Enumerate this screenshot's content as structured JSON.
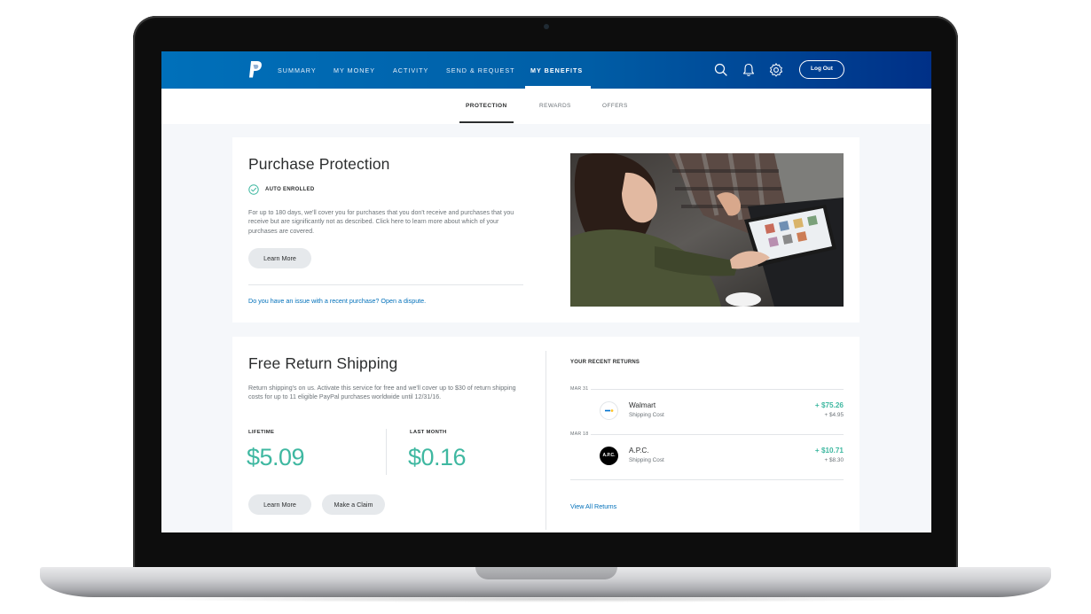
{
  "nav": {
    "items": [
      "SUMMARY",
      "MY MONEY",
      "ACTIVITY",
      "SEND & REQUEST",
      "MY BENEFITS"
    ],
    "active": "MY BENEFITS",
    "logout_label": "Log Out"
  },
  "subnav": {
    "tabs": [
      "PROTECTION",
      "REWARDS",
      "OFFERS"
    ],
    "active": "PROTECTION"
  },
  "purchase_protection": {
    "title": "Purchase Protection",
    "badge": "AUTO ENROLLED",
    "description": "For up to 180 days, we'll cover you for purchases that you don't receive and purchases that you receive but are significantly not as described. Click here to learn more about which of your purchases are covered.",
    "learn_more_label": "Learn More",
    "dispute_link": "Do you have an issue with a recent purchase? Open a dispute."
  },
  "free_return_shipping": {
    "title": "Free Return Shipping",
    "description": "Return shipping's on us. Activate this service for free and we'll cover up to $30 of return shipping costs for up to 11 eligible PayPal purchases worldwide until 12/31/16.",
    "lifetime_label": "LIFETIME",
    "lifetime_value": "$5.09",
    "last_month_label": "LAST MONTH",
    "last_month_value": "$0.16",
    "learn_more_label": "Learn More",
    "make_claim_label": "Make a Claim"
  },
  "recent_returns": {
    "header": "YOUR RECENT RETURNS",
    "items": [
      {
        "date": "MAR 31",
        "merchant": "Walmart",
        "subtitle": "Shipping Cost",
        "amount": "+ $75.26",
        "sub_amount": "+ $4.95"
      },
      {
        "date": "MAR 18",
        "merchant": "A.P.C.",
        "subtitle": "Shipping Cost",
        "amount": "+ $10.71",
        "sub_amount": "+ $8.30",
        "logo_text": "A.P.C."
      }
    ],
    "view_all_label": "View All Returns"
  },
  "colors": {
    "nav_start": "#0070ba",
    "nav_end": "#003087",
    "accent_green": "#3fb8a1",
    "link_blue": "#0070ba"
  },
  "icons": [
    "paypal-logo-icon",
    "search-icon",
    "bell-icon",
    "gear-icon",
    "check-circle-icon"
  ]
}
